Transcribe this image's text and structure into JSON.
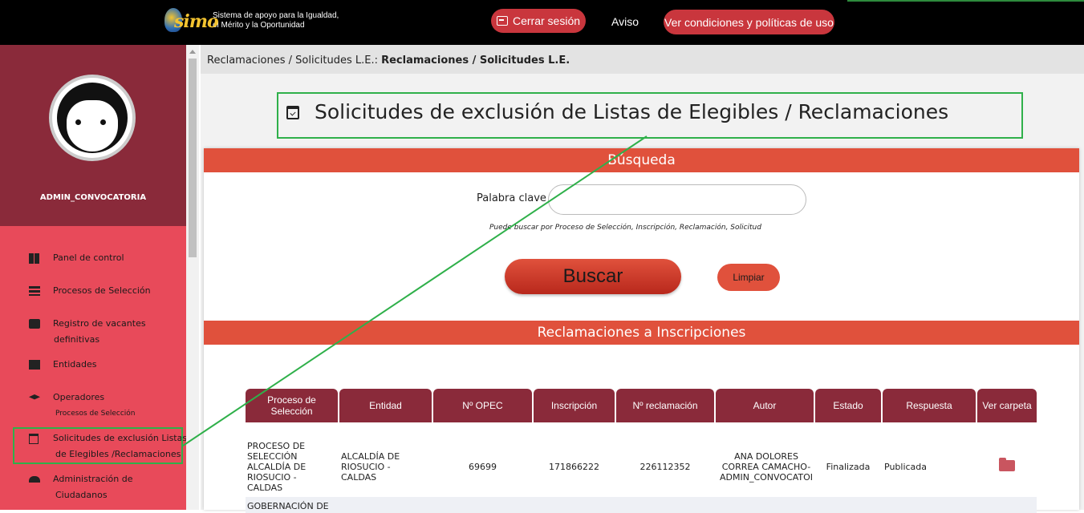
{
  "header": {
    "logo_text": "simo",
    "tagline_1": "Sistema de apoyo para la Igualdad,",
    "tagline_2": "el Mérito y la Oportunidad",
    "logout_label": "Cerrar sesión",
    "notice_label": "Aviso",
    "terms_label": "Ver condiciones y políticas de uso"
  },
  "sidebar": {
    "username": "ADMIN_CONVOCATORIA",
    "items": [
      {
        "label": "Panel de control",
        "icon": "dashboard-icon"
      },
      {
        "label": "Procesos de Selección",
        "icon": "list-icon"
      },
      {
        "label": "Registro de vacantes",
        "sub": "definitivas",
        "icon": "briefcase-icon"
      },
      {
        "label": "Entidades",
        "icon": "building-icon"
      },
      {
        "label": "Operadores",
        "sub": "Procesos de Selección",
        "icon": "graduation-cap-icon"
      },
      {
        "label": "Solicitudes de exclusión Listas",
        "sub": "de Elegibles /Reclamaciones",
        "icon": "calendar-check-icon"
      },
      {
        "label": "Administración de",
        "sub": "Ciudadanos",
        "icon": "people-icon"
      }
    ]
  },
  "breadcrumb": {
    "plain": "Reclamaciones / Solicitudes L.E.:",
    "bold": "Reclamaciones / Solicitudes L.E."
  },
  "page": {
    "title": "Solicitudes de exclusión de Listas de Elegibles / Reclamaciones"
  },
  "search": {
    "heading": "Búsqueda",
    "keyword_label": "Palabra clave",
    "keyword_value": "",
    "hint": "Puede buscar por Proceso de Selección, Inscripción, Reclamación, Solicitud",
    "search_label": "Buscar",
    "clear_label": "Limpiar"
  },
  "results": {
    "heading": "Reclamaciones a Inscripciones",
    "columns": [
      "Proceso de Selección",
      "Entidad",
      "Nº OPEC",
      "Inscripción",
      "Nº reclamación",
      "Autor",
      "Estado",
      "Respuesta",
      "Ver carpeta"
    ],
    "rows": [
      {
        "proceso": "PROCESO DE SELECCIÓN ALCALDÍA DE RIOSUCIO - CALDAS",
        "entidad": "ALCALDÍA DE RIOSUCIO - CALDAS",
        "opec": "69699",
        "inscripcion": "171866222",
        "reclamacion": "226112352",
        "autor": "ANA DOLORES CORREA CAMACHO- ADMIN_CONVOCATOI",
        "estado": "Finalizada",
        "respuesta": "Publicada"
      },
      {
        "proceso": "GOBERNACIÓN DE"
      }
    ]
  },
  "colors": {
    "topbar": "#000000",
    "accent_red": "#e0513c",
    "sidebar": "#e84a5a",
    "table_header": "#8a2a3a",
    "highlight": "#2fb04a"
  }
}
